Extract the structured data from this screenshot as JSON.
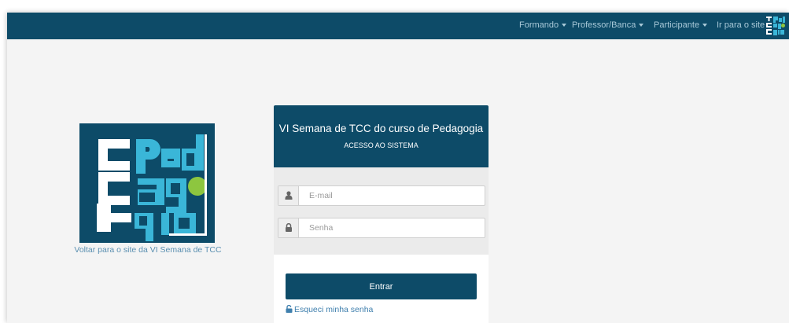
{
  "colors": {
    "navbar": "#0d4b68",
    "accent": "#0d4b68",
    "link": "#3f7fad",
    "logo_blue": "#3ab6d8",
    "logo_green": "#8dc63f",
    "logo_bg": "#0d4b68"
  },
  "navbar": {
    "items": [
      {
        "label": "Formando",
        "dropdown": true
      },
      {
        "label": "Professor/Banca",
        "dropdown": true
      },
      {
        "label": "Participante",
        "dropdown": true
      },
      {
        "label": "Ir para o site",
        "dropdown": false
      }
    ]
  },
  "logo": {
    "line_left": "TCC",
    "line1": "Ped",
    "line2": "ag",
    "line3": "gia",
    "back_link": "Voltar para o site da VI Semana de TCC"
  },
  "login": {
    "title": "VI Semana de TCC do curso de Pedagogia",
    "subtitle": "ACESSO AO SISTEMA",
    "email": {
      "placeholder": "E-mail",
      "value": "",
      "icon": "user-icon"
    },
    "password": {
      "placeholder": "Senha",
      "value": "",
      "icon": "lock-icon"
    },
    "submit_label": "Entrar",
    "forgot_label": "Esqueci minha senha",
    "forgot_icon": "unlock-icon"
  }
}
